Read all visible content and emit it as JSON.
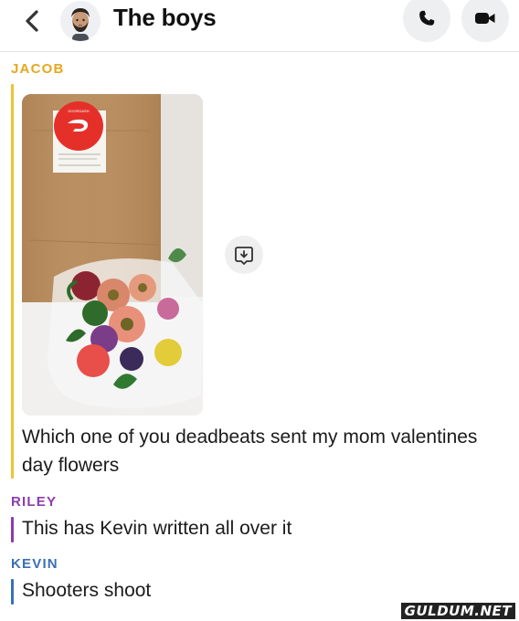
{
  "header": {
    "title": "The boys",
    "back_icon": "chevron-left-icon",
    "avatar_icon": "bitmoji-avatar",
    "call_icon": "phone-icon",
    "video_icon": "video-camera-icon"
  },
  "messages": [
    {
      "sender": "JACOB",
      "sender_color": "#e6a91d",
      "attachment": {
        "type": "photo",
        "description_icon": "photo-flowers-doordash-bag",
        "bag_label": "DOORDASH"
      },
      "text": "Which one of you deadbeats sent my mom valentines day flowers"
    },
    {
      "sender": "RILEY",
      "sender_color": "#8c3cad",
      "text": "This has Kevin written all over it"
    },
    {
      "sender": "KEVIN",
      "sender_color": "#3b6fb6",
      "text": "Shooters shoot"
    }
  ],
  "watermark": "GULDUM.NET",
  "colors": {
    "jacob": "#f2c230",
    "riley": "#8c3cad",
    "kevin": "#3b6fb6"
  }
}
